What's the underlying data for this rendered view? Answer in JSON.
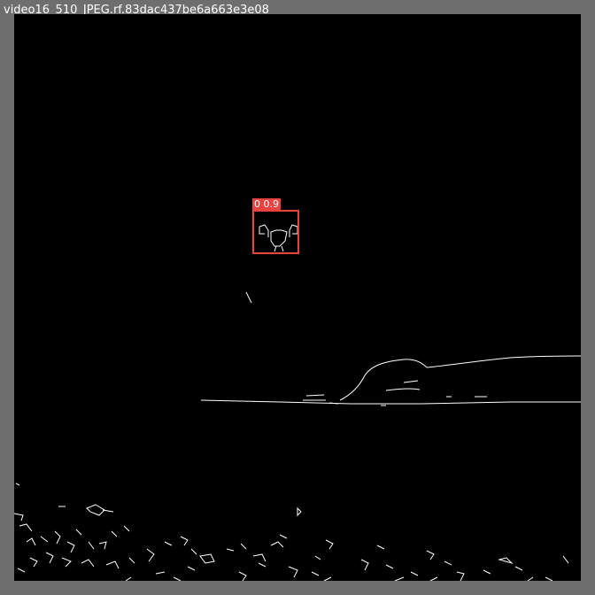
{
  "image": {
    "filename": "video16_510_JPEG.rf.83dac437be6a663e3e08",
    "background_color": "#6e6e6e",
    "canvas_color": "#000000",
    "edge_color": "#ffffff"
  },
  "detection": {
    "label": "0 0.9",
    "box_color": "#e8433f"
  }
}
